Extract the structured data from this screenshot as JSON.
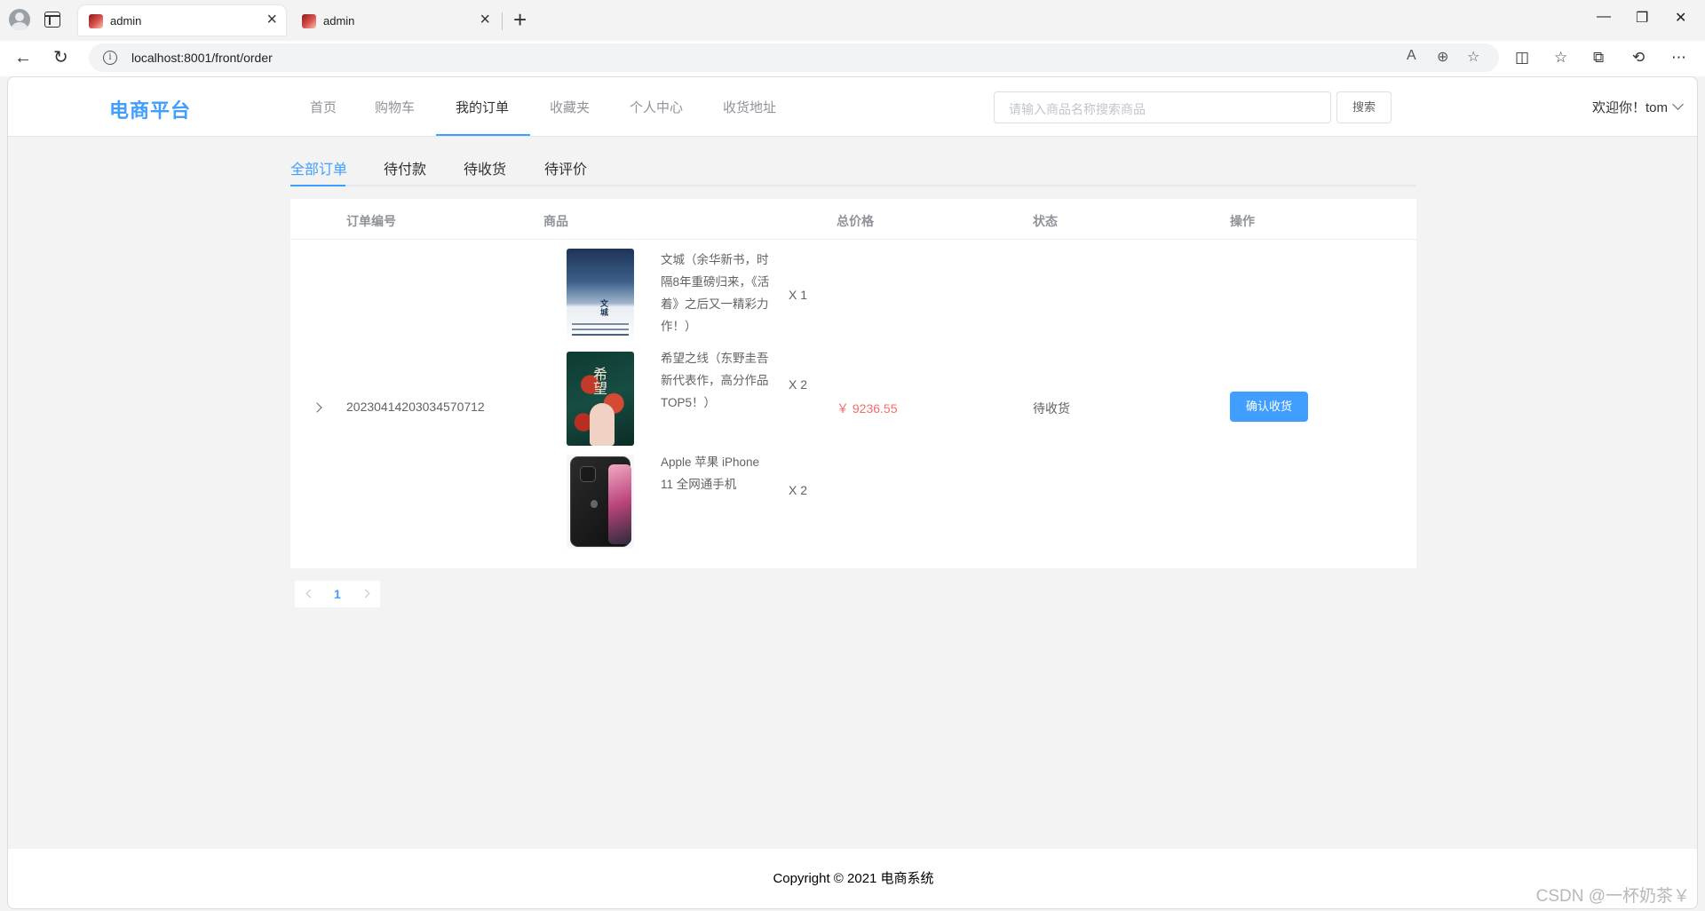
{
  "browser": {
    "tabs": [
      {
        "title": "admin",
        "active": true
      },
      {
        "title": "admin",
        "active": false
      }
    ],
    "url": "localhost:8001/front/order"
  },
  "site": {
    "logo": "电商平台",
    "nav": [
      "首页",
      "购物车",
      "我的订单",
      "收藏夹",
      "个人中心",
      "收货地址"
    ],
    "active_nav": "我的订单",
    "search_placeholder": "请输入商品名称搜索商品",
    "search_button": "搜索",
    "welcome": "欢迎你！tom"
  },
  "order_tabs": [
    "全部订单",
    "待付款",
    "待收货",
    "待评价"
  ],
  "active_order_tab": "全部订单",
  "table": {
    "headers": {
      "order_no": "订单编号",
      "goods": "商品",
      "total": "总价格",
      "status": "状态",
      "action": "操作"
    },
    "order": {
      "order_no": "20230414203034570712",
      "total": "￥ 9236.55",
      "status": "待收货",
      "action_button": "确认收货",
      "items": [
        {
          "name": "文城（余华新书，时隔8年重磅归来，《活着》之后又一精彩力作！）",
          "qty": "X 1",
          "image": "book-cover-wencheng"
        },
        {
          "name": "希望之线（东野圭吾新代表作，高分作品TOP5！）",
          "qty": "X 2",
          "image": "book-cover-xiwangzhixian"
        },
        {
          "name": "Apple 苹果 iPhone 11 全网通手机",
          "qty": "X 2",
          "image": "iphone-11-black"
        }
      ]
    }
  },
  "pagination": {
    "current": "1"
  },
  "footer": {
    "copyright": "Copyright © 2021 电商系统"
  },
  "watermark": "CSDN @一杯奶茶￥",
  "colors": {
    "primary": "#409eff",
    "price": "#f56c6c",
    "text": "#303133",
    "muted": "#909399"
  }
}
